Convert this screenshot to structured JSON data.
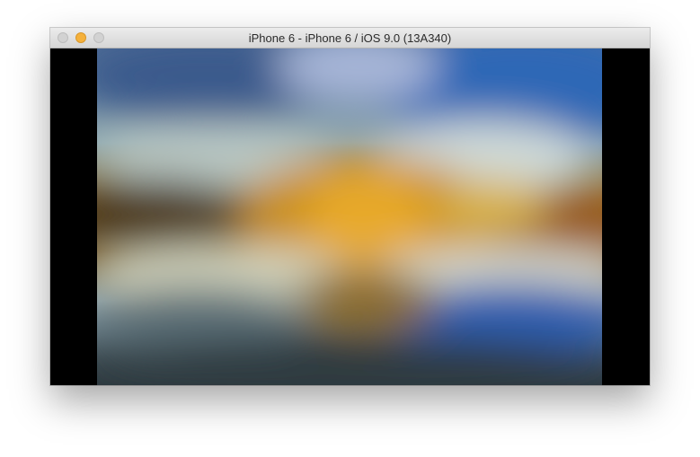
{
  "window": {
    "title": "iPhone 6 - iPhone 6 / iOS 9.0 (13A340)",
    "controls": {
      "close": "close-button",
      "minimize": "minimize-button",
      "zoom": "zoom-button"
    }
  },
  "screen": {
    "content": "blurred-wallpaper",
    "colors": {
      "sky_top": "#4a6fb8",
      "sky_light": "#a9c6d8",
      "horizon": "#b07a1e",
      "mountain_glow": "#e0b23a",
      "water_blue": "#3a63a8",
      "ground_dark": "#2e3a40",
      "letterbox": "#000000"
    }
  }
}
